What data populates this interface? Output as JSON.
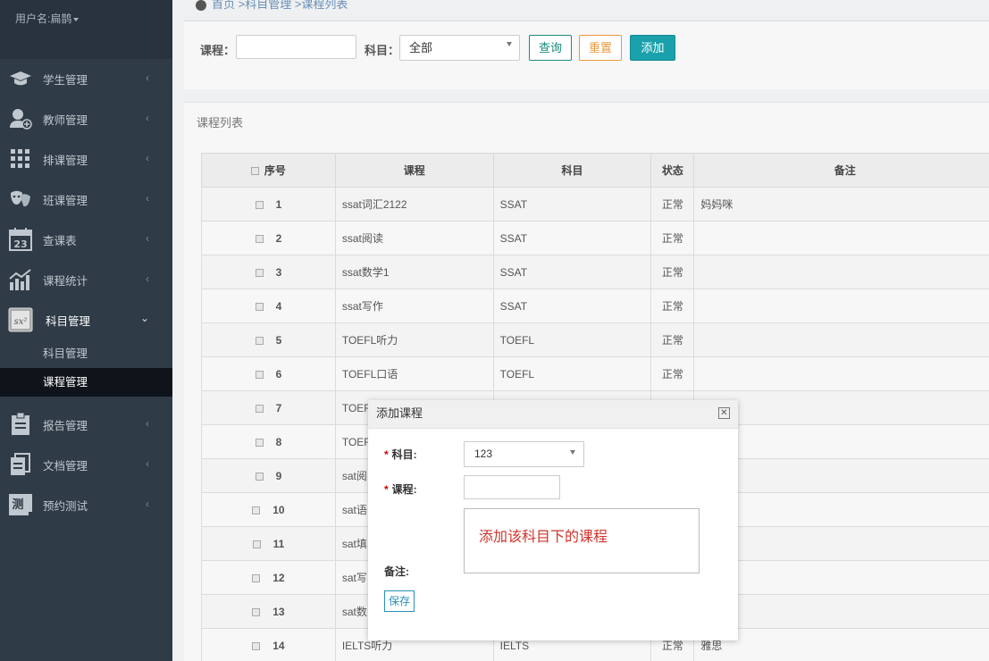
{
  "sidebar": {
    "user_label": "用户名:扁鹊",
    "items": [
      {
        "label": "学生管理",
        "icon": "graduation-cap-icon"
      },
      {
        "label": "教师管理",
        "icon": "teacher-add-icon"
      },
      {
        "label": "排课管理",
        "icon": "grid-icon"
      },
      {
        "label": "班课管理",
        "icon": "masks-icon"
      },
      {
        "label": "查课表",
        "icon": "calendar-icon"
      },
      {
        "label": "课程统计",
        "icon": "stats-chart-icon"
      },
      {
        "label": "科目管理",
        "icon": "formula-icon"
      },
      {
        "label": "报告管理",
        "icon": "clipboard-icon"
      },
      {
        "label": "文档管理",
        "icon": "document-icon"
      },
      {
        "label": "预约测试",
        "icon": "test-icon"
      }
    ],
    "sub_items": [
      {
        "label": "科目管理"
      },
      {
        "label": "课程管理"
      }
    ]
  },
  "breadcrumb": "首页 >科目管理 >课程列表",
  "search": {
    "course_label": "课程：",
    "subject_label": "科目：",
    "subject_value": "全部",
    "query_label": "查询",
    "reset_label": "重置",
    "add_label": "添加"
  },
  "list": {
    "title": "课程列表",
    "headers": {
      "seq": "序号",
      "course": "课程",
      "subject": "科目",
      "status": "状态",
      "note": "备注"
    },
    "rows": [
      {
        "seq": "1",
        "course": "ssat词汇2122",
        "subject": "SSAT",
        "status": "正常",
        "note": "妈妈咪"
      },
      {
        "seq": "2",
        "course": "ssat阅读",
        "subject": "SSAT",
        "status": "正常",
        "note": ""
      },
      {
        "seq": "3",
        "course": "ssat数学1",
        "subject": "SSAT",
        "status": "正常",
        "note": ""
      },
      {
        "seq": "4",
        "course": "ssat写作",
        "subject": "SSAT",
        "status": "正常",
        "note": ""
      },
      {
        "seq": "5",
        "course": "TOEFL听力",
        "subject": "TOEFL",
        "status": "正常",
        "note": ""
      },
      {
        "seq": "6",
        "course": "TOEFL口语",
        "subject": "TOEFL",
        "status": "正常",
        "note": ""
      },
      {
        "seq": "7",
        "course": "TOEF",
        "subject": "",
        "status": "",
        "note": ""
      },
      {
        "seq": "8",
        "course": "TOEF",
        "subject": "",
        "status": "",
        "note": ""
      },
      {
        "seq": "9",
        "course": "sat阅",
        "subject": "",
        "status": "",
        "note": ""
      },
      {
        "seq": "10",
        "course": "sat语",
        "subject": "",
        "status": "",
        "note": ""
      },
      {
        "seq": "11",
        "course": "sat填",
        "subject": "",
        "status": "",
        "note": ""
      },
      {
        "seq": "12",
        "course": "sat写",
        "subject": "",
        "status": "",
        "note": ""
      },
      {
        "seq": "13",
        "course": "sat数",
        "subject": "",
        "status": "",
        "note": ""
      },
      {
        "seq": "14",
        "course": "IELTS听力",
        "subject": "IELTS",
        "status": "正常",
        "note": "雅思"
      }
    ]
  },
  "modal": {
    "title": "添加课程",
    "close_icon": "close-icon",
    "required_mark": "*",
    "subject_label": "科目:",
    "subject_value": "123",
    "course_label": "课程:",
    "note_label": "备注:",
    "annotation": "添加该科目下的课程",
    "save_label": "保存",
    "accent_color": "#d0342c"
  }
}
